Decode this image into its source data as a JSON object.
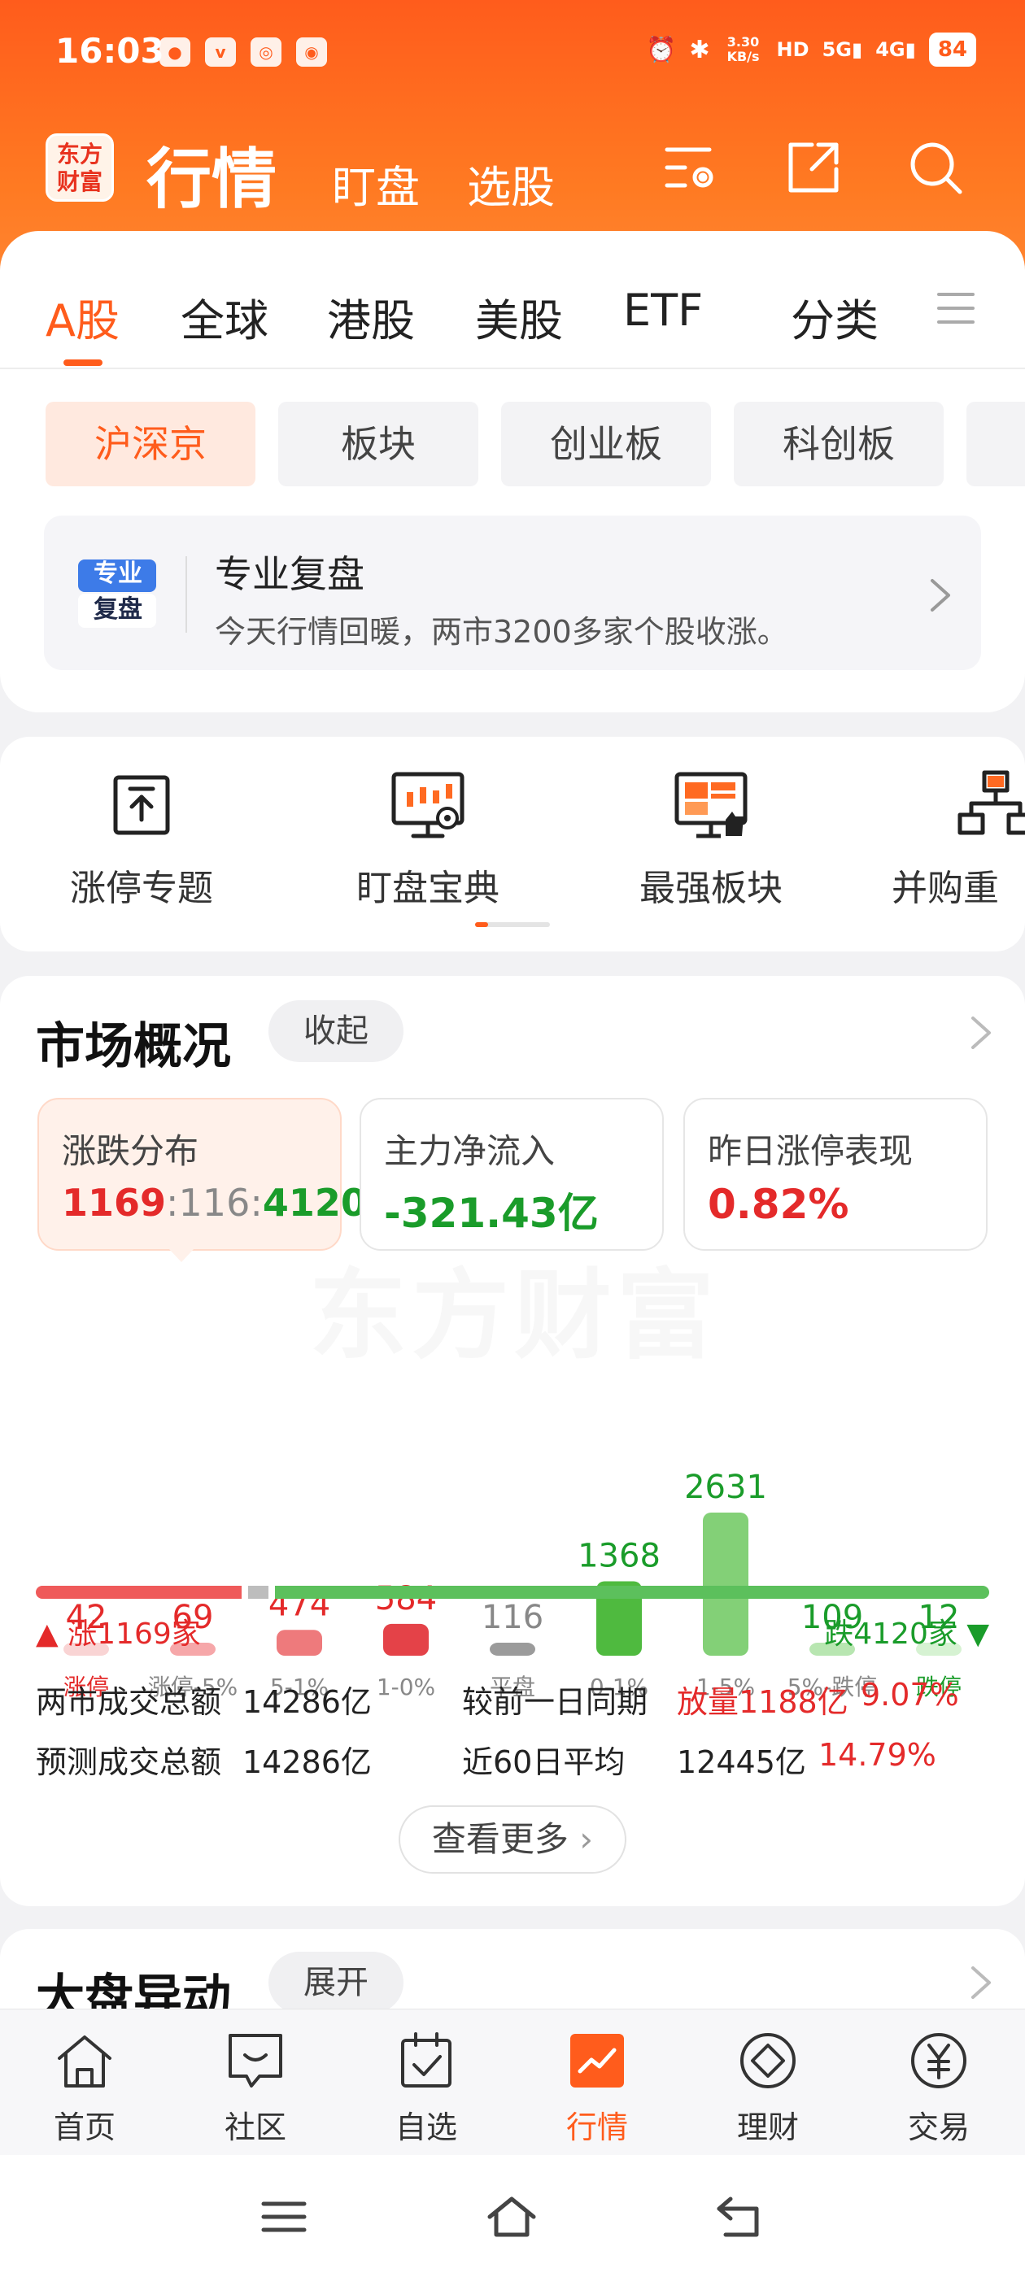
{
  "status_bar": {
    "time": "16:03",
    "network_speed": "3.30 KB/s",
    "signal_5g": "5G",
    "signal_4g": "4G",
    "hd": "HD",
    "battery": "84"
  },
  "header": {
    "logo_text_top": "东方",
    "logo_text_bottom": "财富",
    "title": "行情",
    "nav": [
      "盯盘",
      "选股"
    ]
  },
  "tabs": [
    "A股",
    "全球",
    "港股",
    "美股",
    "ETF",
    "分类"
  ],
  "sub_tabs": [
    "沪深京",
    "板块",
    "创业板",
    "科创板"
  ],
  "review_banner": {
    "badge_top": "专业",
    "badge_bottom": "复盘",
    "title": "专业复盘",
    "description": "今天行情回暖，两市3200多家个股收涨。"
  },
  "tools": [
    "涨停专题",
    "盯盘宝典",
    "最强板块",
    "并购重"
  ],
  "market_overview": {
    "title": "市场概况",
    "collapse_label": "收起",
    "stats": [
      {
        "label": "涨跌分布",
        "value_up": "1169",
        "value_flat": "116",
        "value_down": "4120",
        "sep": ":"
      },
      {
        "label": "主力净流入",
        "value": "-321.43亿"
      },
      {
        "label": "昨日涨停表现",
        "value": "0.82%"
      }
    ],
    "watermark": "东方财富",
    "distribution": [
      {
        "label": "涨停",
        "count": 42,
        "color": "#f9d4d4",
        "label_color": "#e42a2a",
        "count_color": "#e42a2a"
      },
      {
        "label": "涨停-5%",
        "count": 69,
        "color": "#f6a7a9",
        "label_color": "#888888",
        "count_color": "#e42a2a"
      },
      {
        "label": "5-1%",
        "count": 474,
        "color": "#ee7a7c",
        "label_color": "#888888",
        "count_color": "#e42a2a"
      },
      {
        "label": "1-0%",
        "count": 584,
        "color": "#e44248",
        "label_color": "#888888",
        "count_color": "#e42a2a"
      },
      {
        "label": "平盘",
        "count": 116,
        "color": "#9b9b9b",
        "label_color": "#888888",
        "count_color": "#888888"
      },
      {
        "label": "0-1%",
        "count": 1368,
        "color": "#4fba3f",
        "label_color": "#888888",
        "count_color": "#1a9c2a"
      },
      {
        "label": "1-5%",
        "count": 2631,
        "color": "#83d077",
        "label_color": "#888888",
        "count_color": "#1a9c2a"
      },
      {
        "label": "5%-跌停",
        "count": 109,
        "color": "#b8e6b1",
        "label_color": "#888888",
        "count_color": "#1a9c2a"
      },
      {
        "label": "跌停",
        "count": 12,
        "color": "#d6f2d2",
        "label_color": "#1a9c2a",
        "count_color": "#1a9c2a"
      }
    ],
    "up_total": "涨1169家",
    "down_total": "跌4120家",
    "turnover": [
      {
        "label": "两市成交总额",
        "value": "14286亿",
        "compare_label": "较前一日同期",
        "compare_value": "放量1188亿",
        "compare_pct": "9.07%"
      },
      {
        "label": "预测成交总额",
        "value": "14286亿",
        "compare_label": "近60日平均",
        "compare_value": "12445亿",
        "compare_pct": "14.79%"
      }
    ],
    "more_label": "查看更多"
  },
  "market_move": {
    "title": "大盘异动",
    "expand_label": "展开"
  },
  "bottom_nav": [
    {
      "label": "首页",
      "icon": "home-icon"
    },
    {
      "label": "社区",
      "icon": "community-icon"
    },
    {
      "label": "自选",
      "icon": "watchlist-icon"
    },
    {
      "label": "行情",
      "icon": "market-icon"
    },
    {
      "label": "理财",
      "icon": "wealth-icon"
    },
    {
      "label": "交易",
      "icon": "trade-icon"
    }
  ],
  "colors": {
    "brand": "#ff5c1c",
    "up": "#e42a2a",
    "down": "#1a9c2a"
  }
}
